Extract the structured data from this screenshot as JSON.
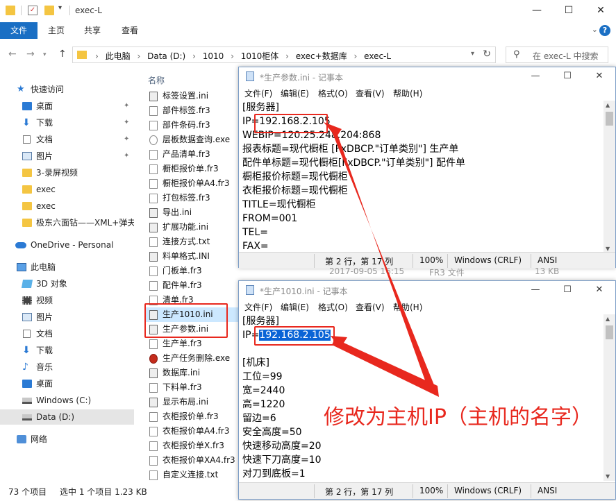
{
  "window": {
    "title": "exec-L",
    "minimize": "—",
    "maximize": "☐",
    "close": "✕"
  },
  "ribbon": {
    "tabs": [
      "文件",
      "主页",
      "共享",
      "查看"
    ],
    "expand": "⌄",
    "help": "?"
  },
  "address": {
    "crumbs": [
      "此电脑",
      "Data (D:)",
      "1010",
      "1010柜体",
      "exec+数据库",
      "exec-L"
    ],
    "separator": "›",
    "search_placeholder": "在 exec-L 中搜索"
  },
  "navpane": {
    "items": [
      {
        "label": "快速访问",
        "icon": "star-icon",
        "pinned": false
      },
      {
        "label": "桌面",
        "icon": "desktop-icon",
        "pinned": true
      },
      {
        "label": "下载",
        "icon": "download-icon",
        "pinned": true
      },
      {
        "label": "文档",
        "icon": "document-icon",
        "pinned": true
      },
      {
        "label": "图片",
        "icon": "picture-icon",
        "pinned": true
      },
      {
        "label": "3-录屏视频",
        "icon": "folder-icon",
        "pinned": false
      },
      {
        "label": "exec",
        "icon": "folder-icon",
        "pinned": false
      },
      {
        "label": "exec",
        "icon": "folder-icon",
        "pinned": false
      },
      {
        "label": "极东六面钻——XML+弹夫",
        "icon": "folder-icon",
        "pinned": false
      },
      {
        "label": "OneDrive - Personal",
        "icon": "cloud-icon",
        "pinned": false
      },
      {
        "label": "此电脑",
        "icon": "computer-icon",
        "pinned": false
      },
      {
        "label": "3D 对象",
        "icon": "3d-objects-icon",
        "pinned": false
      },
      {
        "label": "视频",
        "icon": "video-icon",
        "pinned": false
      },
      {
        "label": "图片",
        "icon": "picture-icon",
        "pinned": false
      },
      {
        "label": "文档",
        "icon": "document-icon",
        "pinned": false
      },
      {
        "label": "下载",
        "icon": "download-icon",
        "pinned": false
      },
      {
        "label": "音乐",
        "icon": "music-icon",
        "pinned": false
      },
      {
        "label": "桌面",
        "icon": "desktop-icon",
        "pinned": false
      },
      {
        "label": "Windows (C:)",
        "icon": "drive-icon",
        "pinned": false
      },
      {
        "label": "Data (D:)",
        "icon": "drive-icon",
        "pinned": false,
        "selected": true
      },
      {
        "label": "网络",
        "icon": "network-icon",
        "pinned": false
      }
    ],
    "pin_glyph": "📌"
  },
  "filelist": {
    "column_header": "名称",
    "files": [
      {
        "name": "标签设置.ini",
        "type": "cfg"
      },
      {
        "name": "部件标签.fr3",
        "type": "doc"
      },
      {
        "name": "部件条码.fr3",
        "type": "doc"
      },
      {
        "name": "层板数据查询.exe",
        "type": "exe"
      },
      {
        "name": "产品清单.fr3",
        "type": "doc"
      },
      {
        "name": "橱柜报价单.fr3",
        "type": "doc"
      },
      {
        "name": "橱柜报价单A4.fr3",
        "type": "doc"
      },
      {
        "name": "打包标签.fr3",
        "type": "doc"
      },
      {
        "name": "导出.ini",
        "type": "cfg"
      },
      {
        "name": "扩展功能.ini",
        "type": "cfg"
      },
      {
        "name": "连接方式.txt",
        "type": "txt"
      },
      {
        "name": "料单格式.INI",
        "type": "cfg"
      },
      {
        "name": "门板单.fr3",
        "type": "doc"
      },
      {
        "name": "配件单.fr3",
        "type": "doc"
      },
      {
        "name": "清单.fr3",
        "type": "doc"
      },
      {
        "name": "生产1010.ini",
        "type": "cfg",
        "selected": true
      },
      {
        "name": "生产参数.ini",
        "type": "cfg"
      },
      {
        "name": "生产单.fr3",
        "type": "doc"
      },
      {
        "name": "生产任务删除.exe",
        "type": "err"
      },
      {
        "name": "数据库.ini",
        "type": "cfg"
      },
      {
        "name": "下料单.fr3",
        "type": "doc"
      },
      {
        "name": "显示布局.ini",
        "type": "cfg"
      },
      {
        "name": "衣柜报价单.fr3",
        "type": "doc"
      },
      {
        "name": "衣柜报价单A4.fr3",
        "type": "doc"
      },
      {
        "name": "衣柜报价单X.fr3",
        "type": "doc"
      },
      {
        "name": "衣柜报价单XA4.fr3",
        "type": "doc"
      },
      {
        "name": "自定义连接.txt",
        "type": "txt"
      }
    ]
  },
  "statusbar": {
    "count": "73 个项目",
    "selected": "选中 1 个项目  1.23 KB"
  },
  "notepad1": {
    "title": "*生产参数.ini - 记事本",
    "menu": [
      "文件(F)",
      "编辑(E)",
      "格式(O)",
      "查看(V)",
      "帮助(H)"
    ],
    "lines": [
      "[服务器]",
      "IP=192.168.2.105",
      "WEBIP=120.25.248.204:868",
      "报表标题=现代橱柜 [FxDBCP.\"订单类别\"] 生产单",
      "配件单标题=现代橱柜[FxDBCP.\"订单类别\"] 配件单",
      "橱柜报价标题=现代橱柜",
      "衣柜报价标题=现代橱柜",
      "TITLE=现代橱柜",
      "FROM=001",
      "TEL=",
      "FAX="
    ],
    "status": {
      "position": "第 2 行，第 17 列",
      "zoom": "100%",
      "eol": "Windows (CRLF)",
      "encoding": "ANSI"
    }
  },
  "behind_detail": {
    "date": "2017-09-05 16:15",
    "type": "FR3 文件",
    "size": "13 KB"
  },
  "notepad2": {
    "title": "*生产1010.ini - 记事本",
    "menu": [
      "文件(F)",
      "编辑(E)",
      "格式(O)",
      "查看(V)",
      "帮助(H)"
    ],
    "ip_prefix": "IP=",
    "ip_value": "192.168.2.105",
    "lines": [
      "[服务器]",
      "",
      "",
      "[机床]",
      "工位=99",
      "宽=2440",
      "高=1220",
      "留边=6",
      "安全高度=50",
      "快速移动高度=20",
      "快速下刀高度=10",
      "对刀到底板=1"
    ],
    "status": {
      "position": "第 2 行，第 17 列",
      "zoom": "100%",
      "eol": "Windows (CRLF)",
      "encoding": "ANSI"
    }
  },
  "annotation": {
    "text": "修改为主机IP（主机的名字）",
    "color": "#e8281e"
  },
  "colors": {
    "accent": "#1a6fc4",
    "selection": "#cce8ff",
    "text_selection": "#0a64d6"
  }
}
